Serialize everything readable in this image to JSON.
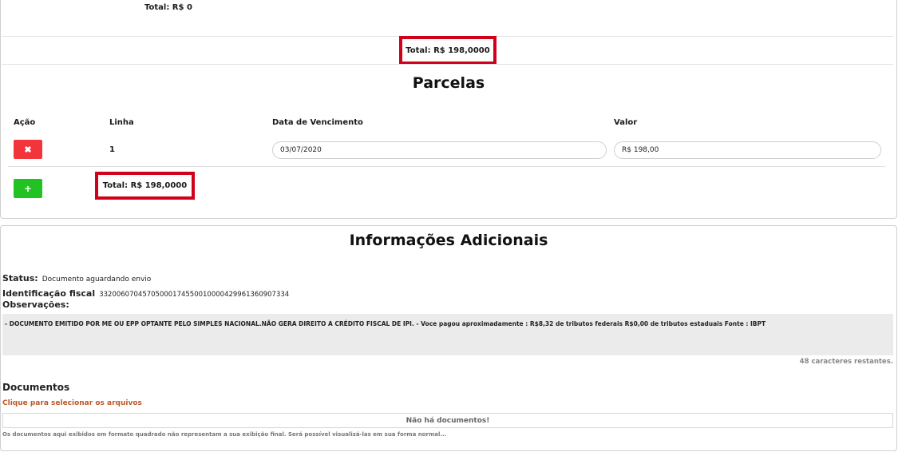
{
  "top": {
    "subtotal": "Total: R$ 0",
    "grand_total": "Total: R$ 198,0000"
  },
  "parcelas": {
    "title": "Parcelas",
    "columns": {
      "acao": "Ação",
      "linha": "Linha",
      "data": "Data de Vencimento",
      "valor": "Valor"
    },
    "rows": [
      {
        "linha": "1",
        "data": "03/07/2020",
        "valor": "R$ 198,00"
      }
    ],
    "delete_icon": "✖",
    "add_icon": "+",
    "total": "Total: R$ 198,0000"
  },
  "info": {
    "title": "Informações Adicionais",
    "status_label": "Status:",
    "status_value": "Documento aguardando envio",
    "fiscal_label": "Identificação fiscal",
    "fiscal_value": "33200607045705000174550010000429961360907334",
    "obs_label": "Observações:",
    "obs_text": "- DOCUMENTO EMITIDO POR ME OU EPP OPTANTE PELO SIMPLES NACIONAL.NÃO GERA DIREITO A CRÉDITO FISCAL DE IPI. - Voce pagou aproximadamente : R$8,32 de tributos federais R$0,00 de tributos estaduais Fonte : IBPT",
    "chars_remaining": "48 caracteres restantes."
  },
  "documentos": {
    "title": "Documentos",
    "select_link": "Clique para selecionar os arquivos",
    "empty": "Não há documentos!",
    "note": "Os documentos aqui exibidos em formato quadrado não representam a sua exibição final. Será possível visualizá-las em sua forma normal..."
  },
  "colors": {
    "highlight": "#d0021b",
    "delete": "#f2353b",
    "add": "#21c323",
    "link": "#c0562a"
  }
}
